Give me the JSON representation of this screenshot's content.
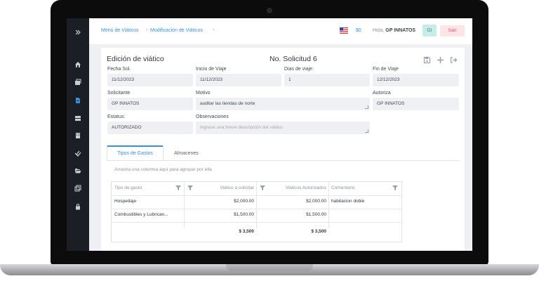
{
  "breadcrumb": {
    "items": [
      "Menú de Viáticos",
      "Modificación de Viáticos"
    ]
  },
  "header": {
    "amount": "$0",
    "greeting": "Hola,",
    "user": "GP INNATOS",
    "avatar_initials": "GI",
    "logout_label": "Salir"
  },
  "form": {
    "title": "Edición de viático",
    "request_number": "No. Solicitud 6",
    "fields": {
      "fecha_sol": {
        "label": "Fecha Sol.",
        "value": "11/12/2023"
      },
      "inicio_viaje": {
        "label": "Inicio de Viaje",
        "value": "11/12/2023"
      },
      "dias_viaje": {
        "label": "Dias de viaje:",
        "value": "1"
      },
      "fin_viaje": {
        "label": "Fin de Viaje",
        "value": "12/12/2023"
      },
      "solicitante": {
        "label": "Solicitante",
        "value": "GP INNATOS"
      },
      "motivo": {
        "label": "Motivo",
        "value": "auditar las tiendas de norte"
      },
      "autoriza": {
        "label": "Autoriza",
        "value": "GP INNATOS"
      },
      "estatus": {
        "label": "Estatus:",
        "value": "AUTORIZADO"
      },
      "observaciones": {
        "label": "Observaciones",
        "placeholder": "Ingrese una breve descripción del viático"
      }
    }
  },
  "tabs": [
    "Tipos de Gastos",
    "Almacenes"
  ],
  "grid": {
    "group_hint": "Arrastra una columna aquí para agrupar por ella",
    "columns": [
      "Tipo de gasto",
      "Viático a solicitar",
      "Viáticos Autorizados",
      "Comentario"
    ],
    "rows": [
      [
        "Hospedaje",
        "$2,000.00",
        "$2,000.00",
        "habitacion doble"
      ],
      [
        "Combustibles y Lubrican...",
        "$1,500.00",
        "$1,500.00",
        ""
      ]
    ],
    "totals": [
      "$ 3,500",
      "$ 3,500"
    ]
  }
}
